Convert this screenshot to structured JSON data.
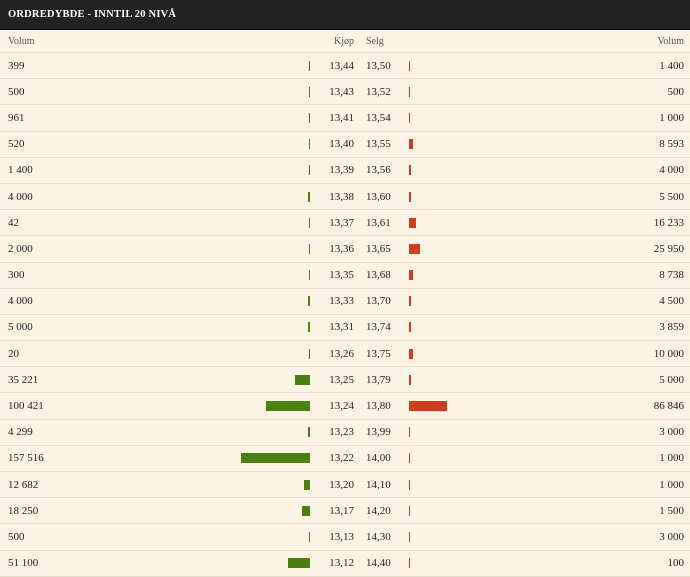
{
  "title": "ORDREDYBDE - INNTIL 20 NIVÅ",
  "headers": {
    "buy_volume": "Volum",
    "buy_price": "Kjøp",
    "sell_price": "Selg",
    "sell_volume": "Volum"
  },
  "colors": {
    "buy": "#4a7f14",
    "sell": "#d13c1e",
    "header_bg": "#222222",
    "panel_bg": "#fbf3e4"
  },
  "rows": [
    {
      "buy_volume": "399",
      "buy": 399,
      "buy_price": "13,44",
      "sell_price": "13,50",
      "sell": 1400,
      "sell_volume": "1 400"
    },
    {
      "buy_volume": "500",
      "buy": 500,
      "buy_price": "13,43",
      "sell_price": "13,52",
      "sell": 500,
      "sell_volume": "500"
    },
    {
      "buy_volume": "961",
      "buy": 961,
      "buy_price": "13,41",
      "sell_price": "13,54",
      "sell": 1000,
      "sell_volume": "1 000"
    },
    {
      "buy_volume": "520",
      "buy": 520,
      "buy_price": "13,40",
      "sell_price": "13,55",
      "sell": 8593,
      "sell_volume": "8 593"
    },
    {
      "buy_volume": "1 400",
      "buy": 1400,
      "buy_price": "13,39",
      "sell_price": "13,56",
      "sell": 4000,
      "sell_volume": "4 000"
    },
    {
      "buy_volume": "4 000",
      "buy": 4000,
      "buy_price": "13,38",
      "sell_price": "13,60",
      "sell": 5500,
      "sell_volume": "5 500"
    },
    {
      "buy_volume": "42",
      "buy": 42,
      "buy_price": "13,37",
      "sell_price": "13,61",
      "sell": 16233,
      "sell_volume": "16 233"
    },
    {
      "buy_volume": "2 000",
      "buy": 2000,
      "buy_price": "13,36",
      "sell_price": "13,65",
      "sell": 25950,
      "sell_volume": "25 950"
    },
    {
      "buy_volume": "300",
      "buy": 300,
      "buy_price": "13,35",
      "sell_price": "13,68",
      "sell": 8738,
      "sell_volume": "8 738"
    },
    {
      "buy_volume": "4 000",
      "buy": 4000,
      "buy_price": "13,33",
      "sell_price": "13,70",
      "sell": 4500,
      "sell_volume": "4 500"
    },
    {
      "buy_volume": "5 000",
      "buy": 5000,
      "buy_price": "13,31",
      "sell_price": "13,74",
      "sell": 3859,
      "sell_volume": "3 859"
    },
    {
      "buy_volume": "20",
      "buy": 20,
      "buy_price": "13,26",
      "sell_price": "13,75",
      "sell": 10000,
      "sell_volume": "10 000"
    },
    {
      "buy_volume": "35 221",
      "buy": 35221,
      "buy_price": "13,25",
      "sell_price": "13,79",
      "sell": 5000,
      "sell_volume": "5 000"
    },
    {
      "buy_volume": "100 421",
      "buy": 100421,
      "buy_price": "13,24",
      "sell_price": "13,80",
      "sell": 86846,
      "sell_volume": "86 846"
    },
    {
      "buy_volume": "4 299",
      "buy": 4299,
      "buy_price": "13,23",
      "sell_price": "13,99",
      "sell": 3000,
      "sell_volume": "3 000"
    },
    {
      "buy_volume": "157 516",
      "buy": 157516,
      "buy_price": "13,22",
      "sell_price": "14,00",
      "sell": 1000,
      "sell_volume": "1 000"
    },
    {
      "buy_volume": "12 682",
      "buy": 12682,
      "buy_price": "13,20",
      "sell_price": "14,10",
      "sell": 1000,
      "sell_volume": "1 000"
    },
    {
      "buy_volume": "18 250",
      "buy": 18250,
      "buy_price": "13,17",
      "sell_price": "14,20",
      "sell": 1500,
      "sell_volume": "1 500"
    },
    {
      "buy_volume": "500",
      "buy": 500,
      "buy_price": "13,13",
      "sell_price": "14,30",
      "sell": 3000,
      "sell_volume": "3 000"
    },
    {
      "buy_volume": "51 100",
      "buy": 51100,
      "buy_price": "13,12",
      "sell_price": "14,40",
      "sell": 100,
      "sell_volume": "100"
    }
  ]
}
